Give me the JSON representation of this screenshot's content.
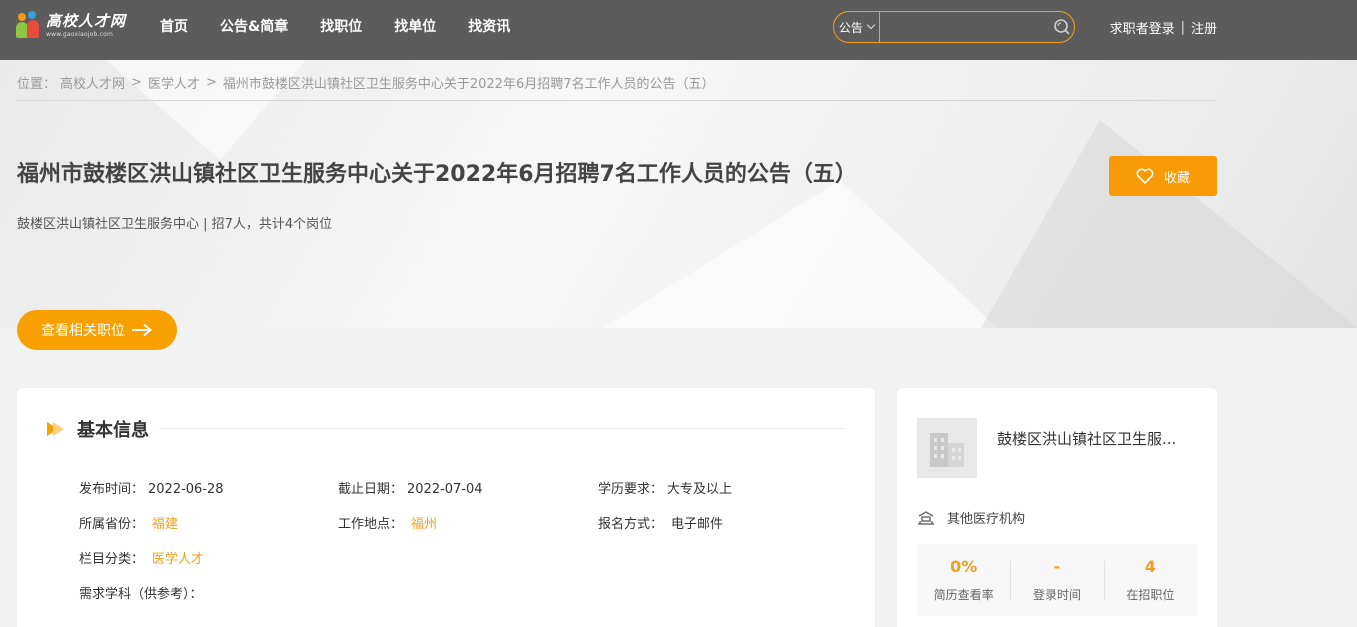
{
  "header": {
    "logo_text": "高校人才网",
    "logo_subtext": "www.gaoxiaojob.com",
    "nav": [
      "首页",
      "公告&简章",
      "找职位",
      "找单位",
      "找资讯"
    ],
    "search": {
      "type_label": "公告",
      "placeholder": ""
    },
    "login_label": "求职者登录",
    "register_label": "注册",
    "separator": "|"
  },
  "breadcrumb": {
    "prefix": "位置：",
    "items": [
      "高校人才网",
      "医学人才",
      "福州市鼓楼区洪山镇社区卫生服务中心关于2022年6月招聘7名工作人员的公告（五）"
    ]
  },
  "job": {
    "title": "福州市鼓楼区洪山镇社区卫生服务中心关于2022年6月招聘7名工作人员的公告（五）",
    "subtitle": "鼓楼区洪山镇社区卫生服务中心 | 招7人，共计4个岗位",
    "favorite_label": "收藏",
    "related_label": "查看相关职位"
  },
  "basic_info": {
    "title": "基本信息",
    "fields": {
      "publish_time_label": "发布时间：",
      "publish_time": "2022-06-28",
      "deadline_label": "截止日期：",
      "deadline": "2022-07-04",
      "education_label": "学历要求：",
      "education": "大专及以上",
      "province_label": "所属省份：",
      "province": "福建",
      "location_label": "工作地点：",
      "location": "福州",
      "apply_label": "报名方式：",
      "apply": "电子邮件",
      "category_label": "栏目分类：",
      "category": "医学人才",
      "discipline_label": "需求学科（供参考）："
    }
  },
  "company": {
    "name": "鼓楼区洪山镇社区卫生服...",
    "type": "其他医疗机构",
    "stats": [
      {
        "value": "0%",
        "label": "简历查看率"
      },
      {
        "value": "-",
        "label": "登录时间"
      },
      {
        "value": "4",
        "label": "在招职位"
      }
    ]
  },
  "colors": {
    "accent": "#f7a000",
    "header_bg": "#5c5c5c",
    "highlight": "#f0a020"
  }
}
